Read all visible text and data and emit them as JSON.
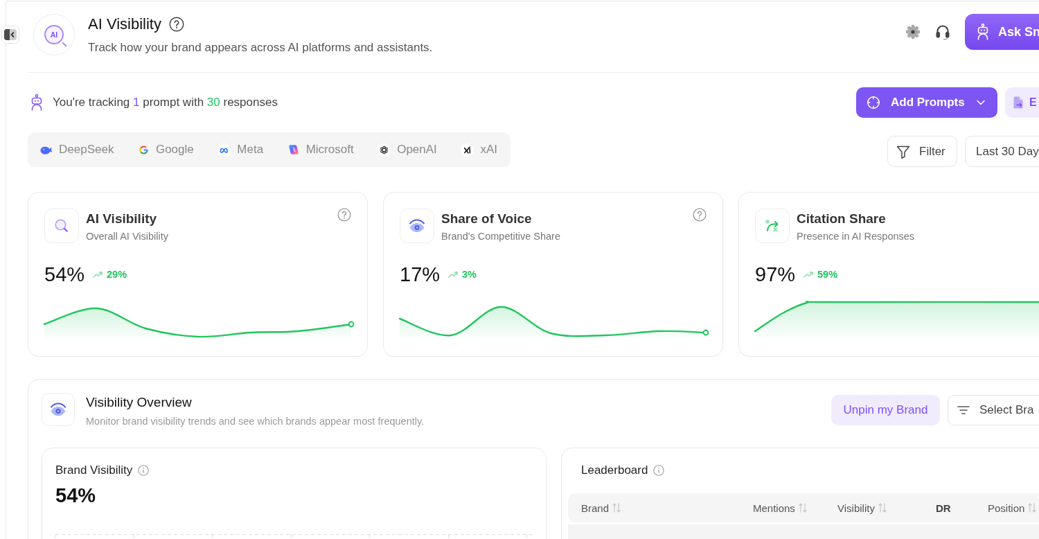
{
  "header": {
    "logo_text": "AI",
    "title": "AI Visibility",
    "subtitle": "Track how your brand appears across AI platforms and assistants.",
    "assistant_button": "Ask Sn"
  },
  "tracking": {
    "before": "You're tracking",
    "prompts": "1",
    "middle": "prompt with",
    "responses": "30",
    "after": "responses"
  },
  "actions": {
    "add_prompts": "Add Prompts",
    "export": "E"
  },
  "providers": [
    {
      "name": "DeepSeek"
    },
    {
      "name": "Google"
    },
    {
      "name": "Meta"
    },
    {
      "name": "Microsoft"
    },
    {
      "name": "OpenAI"
    },
    {
      "name": "xAI"
    }
  ],
  "filters": {
    "filter": "Filter",
    "date_range": "Last 30 Day"
  },
  "metrics": [
    {
      "title": "AI Visibility",
      "subtitle": "Overall AI Visibility",
      "value": "54%",
      "change": "29%"
    },
    {
      "title": "Share of Voice",
      "subtitle": "Brand's Competitive Share",
      "value": "17%",
      "change": "3%"
    },
    {
      "title": "Citation Share",
      "subtitle": "Presence in AI Responses",
      "value": "97%",
      "change": "59%"
    }
  ],
  "overview": {
    "title": "Visibility Overview",
    "subtitle": "Monitor brand visibility trends and see which brands appear most frequently.",
    "unpin_button": "Unpin my Brand",
    "select_button": "Select Bra",
    "brand_visibility": {
      "title": "Brand Visibility",
      "value": "54%"
    },
    "leaderboard": {
      "title": "Leaderboard",
      "columns": [
        {
          "label": "Brand",
          "sortable": true
        },
        {
          "label": "Mentions",
          "sortable": true
        },
        {
          "label": "Visibility",
          "sortable": true
        },
        {
          "label": "DR",
          "sortable": false
        },
        {
          "label": "Position",
          "sortable": true
        }
      ]
    }
  }
}
